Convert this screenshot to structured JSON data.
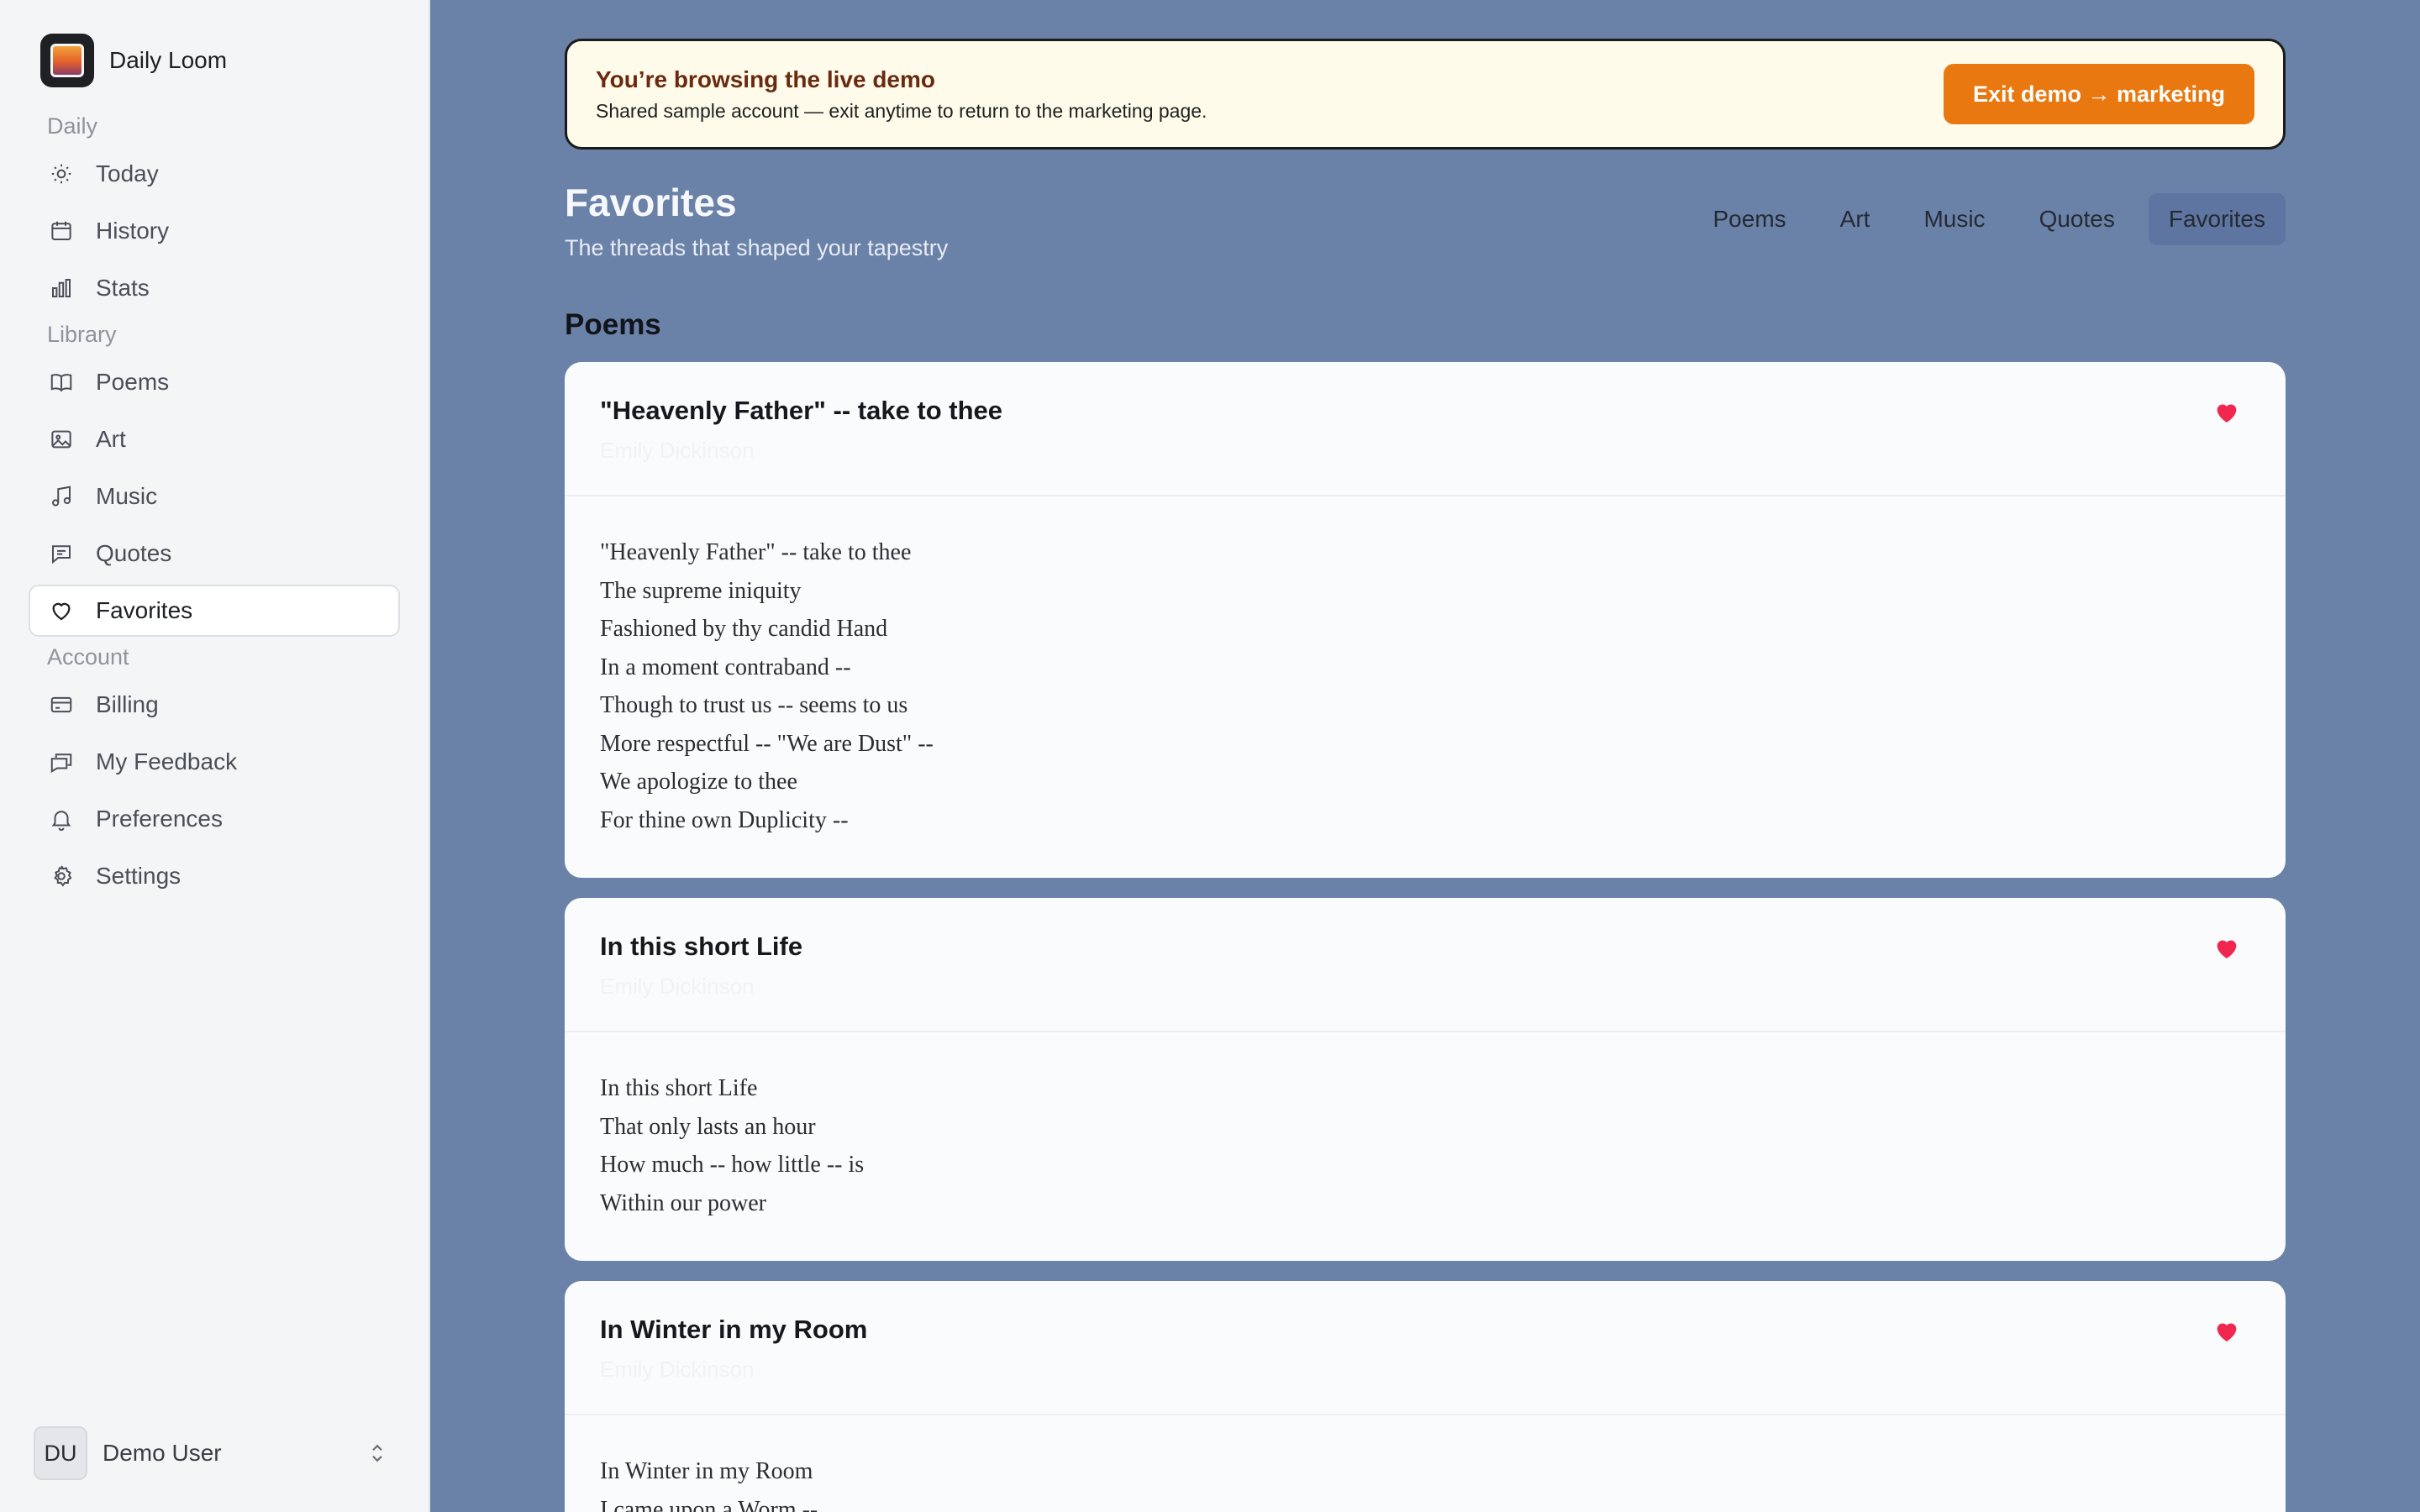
{
  "brand": {
    "name": "Daily Loom"
  },
  "sidebar": {
    "sections": [
      {
        "label": "Daily",
        "items": [
          {
            "label": "Today",
            "icon": "sun-icon"
          },
          {
            "label": "History",
            "icon": "calendar-icon"
          },
          {
            "label": "Stats",
            "icon": "bar-chart-icon"
          }
        ]
      },
      {
        "label": "Library",
        "items": [
          {
            "label": "Poems",
            "icon": "book-icon"
          },
          {
            "label": "Art",
            "icon": "image-icon"
          },
          {
            "label": "Music",
            "icon": "music-note-icon"
          },
          {
            "label": "Quotes",
            "icon": "quote-bubble-icon"
          },
          {
            "label": "Favorites",
            "icon": "heart-icon",
            "active": true
          }
        ]
      },
      {
        "label": "Account",
        "items": [
          {
            "label": "Billing",
            "icon": "credit-card-icon"
          },
          {
            "label": "My Feedback",
            "icon": "feedback-icon"
          },
          {
            "label": "Preferences",
            "icon": "bell-icon"
          },
          {
            "label": "Settings",
            "icon": "gear-icon"
          }
        ]
      }
    ]
  },
  "user": {
    "initials": "DU",
    "name": "Demo User",
    "icon": "chevron-up-down-icon"
  },
  "banner": {
    "title": "You’re browsing the live demo",
    "subtitle": "Shared sample account — exit anytime to return to the marketing page.",
    "button_label": "Exit demo → marketing"
  },
  "page": {
    "title": "Favorites",
    "subtitle": "The threads that shaped your tapestry",
    "tabs": [
      {
        "label": "Poems"
      },
      {
        "label": "Art"
      },
      {
        "label": "Music"
      },
      {
        "label": "Quotes"
      },
      {
        "label": "Favorites",
        "active": true
      }
    ],
    "section_title": "Poems"
  },
  "poems": [
    {
      "title": "\"Heavenly Father\" -- take to thee",
      "author": "Emily Dickinson",
      "lines": [
        "\"Heavenly Father\" -- take to thee",
        "The supreme iniquity",
        "Fashioned by thy candid Hand",
        "In a moment contraband --",
        "Though to trust us -- seems to us",
        "More respectful -- \"We are Dust\" --",
        "We apologize to thee",
        "For thine own Duplicity --"
      ]
    },
    {
      "title": "In this short Life",
      "author": "Emily Dickinson",
      "lines": [
        "In this short Life",
        "That only lasts an hour",
        "How much -- how little -- is",
        "Within our power"
      ]
    },
    {
      "title": "In Winter in my Room",
      "author": "Emily Dickinson",
      "lines": [
        "In Winter in my Room",
        "I came upon a Worm --"
      ]
    }
  ],
  "colors": {
    "main_bg": "#6b82a8",
    "accent": "#e8780f",
    "heart": "#f0284f",
    "sidebar_bg": "#f4f5f7"
  }
}
